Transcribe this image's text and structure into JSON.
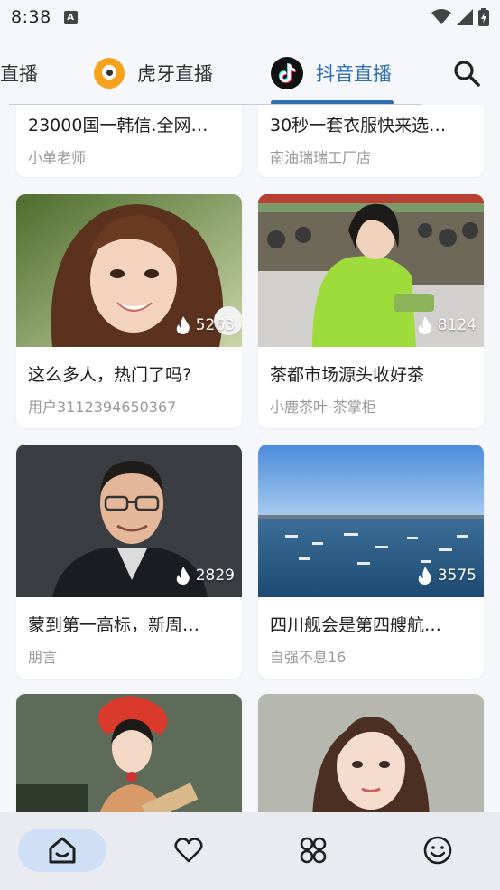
{
  "status_bar": {
    "time": "8:38",
    "notification_icon": "A"
  },
  "tabs": [
    {
      "label": "直播",
      "partial_label": "直播"
    },
    {
      "label": "虎牙直播",
      "icon": "huya-logo"
    },
    {
      "label": "抖音直播",
      "icon": "douyin-logo",
      "active": true
    }
  ],
  "colors": {
    "accent": "#2f6fb1",
    "background": "#f6f7fb",
    "nav_active": "#cfe0f6"
  },
  "feed": {
    "top_cards": [
      {
        "title": "23000国一韩信.全网…",
        "author": "小单老师"
      },
      {
        "title": "30秒一套衣服快来选…",
        "author": "南油瑞瑞工厂店"
      }
    ],
    "cards": [
      {
        "title": "这么多人，热门了吗?",
        "author": "用户3112394650367",
        "heat": "5263"
      },
      {
        "title": "茶都市场源头收好茶",
        "author": "小鹿茶叶-茶掌柜",
        "heat": "8124"
      },
      {
        "title": "蒙到第一高标，新周…",
        "author": "朋言",
        "heat": "2829"
      },
      {
        "title": "四川舰会是第四艘航…",
        "author": "自强不息16",
        "heat": "3575"
      }
    ]
  },
  "bottom_nav": [
    "home-icon",
    "heart-icon",
    "apps-icon",
    "smile-icon"
  ]
}
